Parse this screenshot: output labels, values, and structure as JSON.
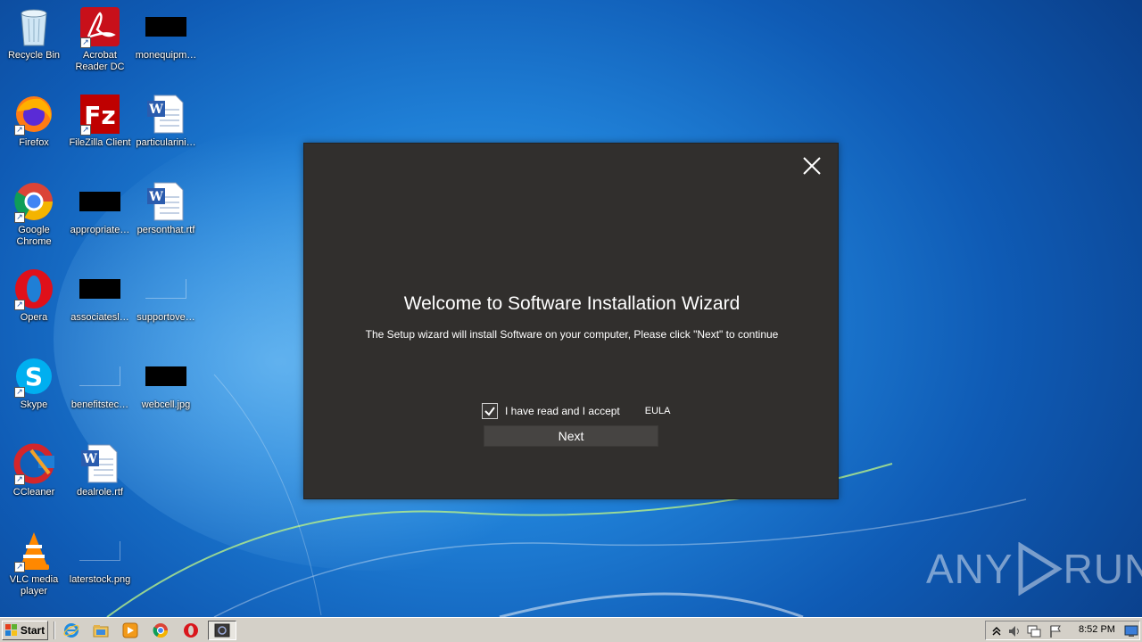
{
  "desktop": {
    "icons": [
      {
        "label": "Recycle Bin",
        "icon": "recycle-bin-icon"
      },
      {
        "label": "Acrobat Reader DC",
        "icon": "acrobat-icon"
      },
      {
        "label": "monequipm…",
        "icon": "black-file-icon"
      },
      {
        "label": "Firefox",
        "icon": "firefox-icon"
      },
      {
        "label": "FileZilla Client",
        "icon": "filezilla-icon"
      },
      {
        "label": "particularini…",
        "icon": "word-doc-icon"
      },
      {
        "label": "Google Chrome",
        "icon": "chrome-icon"
      },
      {
        "label": "appropriate…",
        "icon": "black-file-icon"
      },
      {
        "label": "personthat.rtf",
        "icon": "word-doc-icon"
      },
      {
        "label": "Opera",
        "icon": "opera-icon"
      },
      {
        "label": "associatesl…",
        "icon": "black-file-icon"
      },
      {
        "label": "supportove…",
        "icon": "blank-file-icon"
      },
      {
        "label": "Skype",
        "icon": "skype-icon"
      },
      {
        "label": "benefitstec…",
        "icon": "blank-file-icon"
      },
      {
        "label": "webcell.jpg",
        "icon": "black-file-icon"
      },
      {
        "label": "CCleaner",
        "icon": "ccleaner-icon"
      },
      {
        "label": "dealrole.rtf",
        "icon": "word-doc-icon"
      },
      {
        "label": "VLC media player",
        "icon": "vlc-icon"
      },
      {
        "label": "laterstock.png",
        "icon": "blank-file-icon"
      }
    ]
  },
  "wizard": {
    "title": "Welcome to Software Installation Wizard",
    "subtitle": "The Setup wizard will install Software on your computer, Please click \"Next\" to continue",
    "accept_label": "I have read and I accept",
    "accept_checked": true,
    "eula_label": "EULA",
    "next_label": "Next"
  },
  "watermark": {
    "left": "ANY",
    "right": "RUN"
  },
  "taskbar": {
    "start_label": "Start",
    "pinned": [
      "ie-icon",
      "explorer-icon",
      "media-player-icon",
      "chrome-icon",
      "opera-icon"
    ],
    "active_app": "installer-icon",
    "clock": "8:52 PM"
  }
}
